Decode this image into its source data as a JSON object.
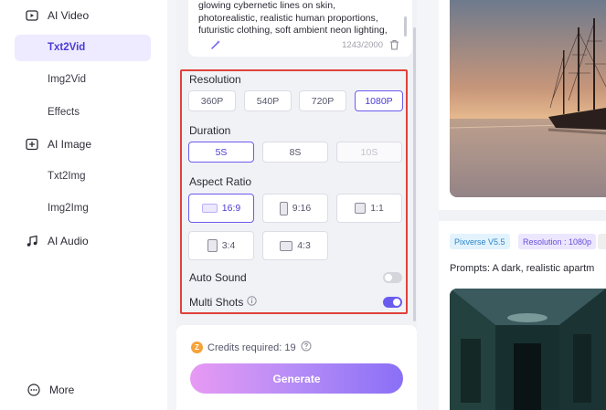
{
  "sidebar": {
    "sections": [
      {
        "label": "AI Video",
        "icon": "video-icon"
      },
      {
        "label": "AI Image",
        "icon": "image-icon"
      },
      {
        "label": "AI Audio",
        "icon": "music-icon"
      }
    ],
    "items": {
      "txt2vid": "Txt2Vid",
      "img2vid": "Img2Vid",
      "effects": "Effects",
      "txt2img": "Txt2Img",
      "img2img": "Img2Img"
    },
    "more": "More"
  },
  "prompt": {
    "text": "glowing cybernetic lines on skin, photorealistic, realistic human proportions, futuristic clothing, soft ambient neon lighting,",
    "count": "1243/2000"
  },
  "settings": {
    "resolution": {
      "label": "Resolution",
      "options": [
        "360P",
        "540P",
        "720P",
        "1080P"
      ],
      "selected": "1080P"
    },
    "duration": {
      "label": "Duration",
      "options": [
        "5S",
        "8S",
        "10S"
      ],
      "selected": "5S",
      "disabled": "10S"
    },
    "aspect_ratio": {
      "label": "Aspect Ratio",
      "options": [
        "16:9",
        "9:16",
        "1:1",
        "3:4",
        "4:3"
      ],
      "selected": "16:9"
    },
    "auto_sound": {
      "label": "Auto Sound",
      "enabled": false
    },
    "multi_shots": {
      "label": "Multi Shots",
      "enabled": true
    }
  },
  "footer": {
    "credits": "Credits required: 19",
    "generate": "Generate"
  },
  "gallery": {
    "badges": [
      "Pixverse V5.5",
      "Resolution : 1080p"
    ],
    "prompts": "Prompts: A dark, realistic apartm"
  },
  "colors": {
    "accent": "#6b5cf0",
    "highlight_border": "#e0413a",
    "generate_gradient": [
      "#e79af3",
      "#8a6ff6"
    ]
  }
}
